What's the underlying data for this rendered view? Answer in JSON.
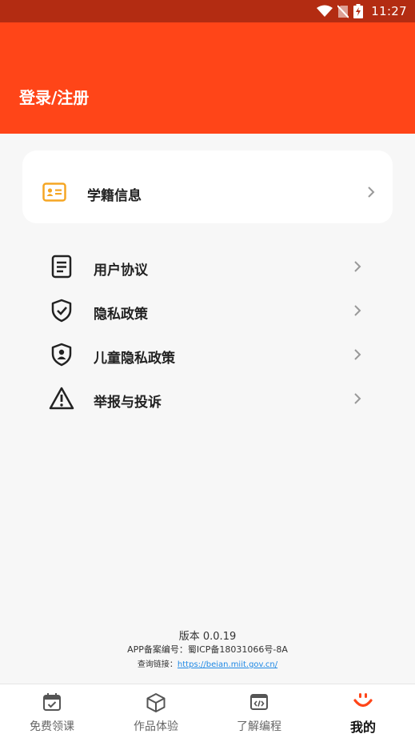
{
  "status_bar": {
    "time": "11:27"
  },
  "header": {
    "title": "登录/注册"
  },
  "card": {
    "label": "学籍信息",
    "icon": "id-card-icon"
  },
  "menu": [
    {
      "label": "用户协议",
      "icon": "document-icon"
    },
    {
      "label": "隐私政策",
      "icon": "shield-check-icon"
    },
    {
      "label": "儿童隐私政策",
      "icon": "shield-person-icon"
    },
    {
      "label": "举报与投诉",
      "icon": "warning-icon"
    }
  ],
  "footer": {
    "version": "版本 0.0.19",
    "record": "APP备案编号：蜀ICP备18031066号-8A",
    "query_label": "查询链接：",
    "query_link": "https://beian.miit.gov.cn/"
  },
  "tabs": [
    {
      "label": "免费领课",
      "icon": "calendar-check-icon"
    },
    {
      "label": "作品体验",
      "icon": "cube-icon"
    },
    {
      "label": "了解编程",
      "icon": "code-window-icon"
    },
    {
      "label": "我的",
      "icon": "smile-icon",
      "active": true
    }
  ],
  "colors": {
    "header": "#ff4518",
    "status_bar": "#b32c12",
    "accent": "#ff4518",
    "card_icon": "#f5a623"
  }
}
